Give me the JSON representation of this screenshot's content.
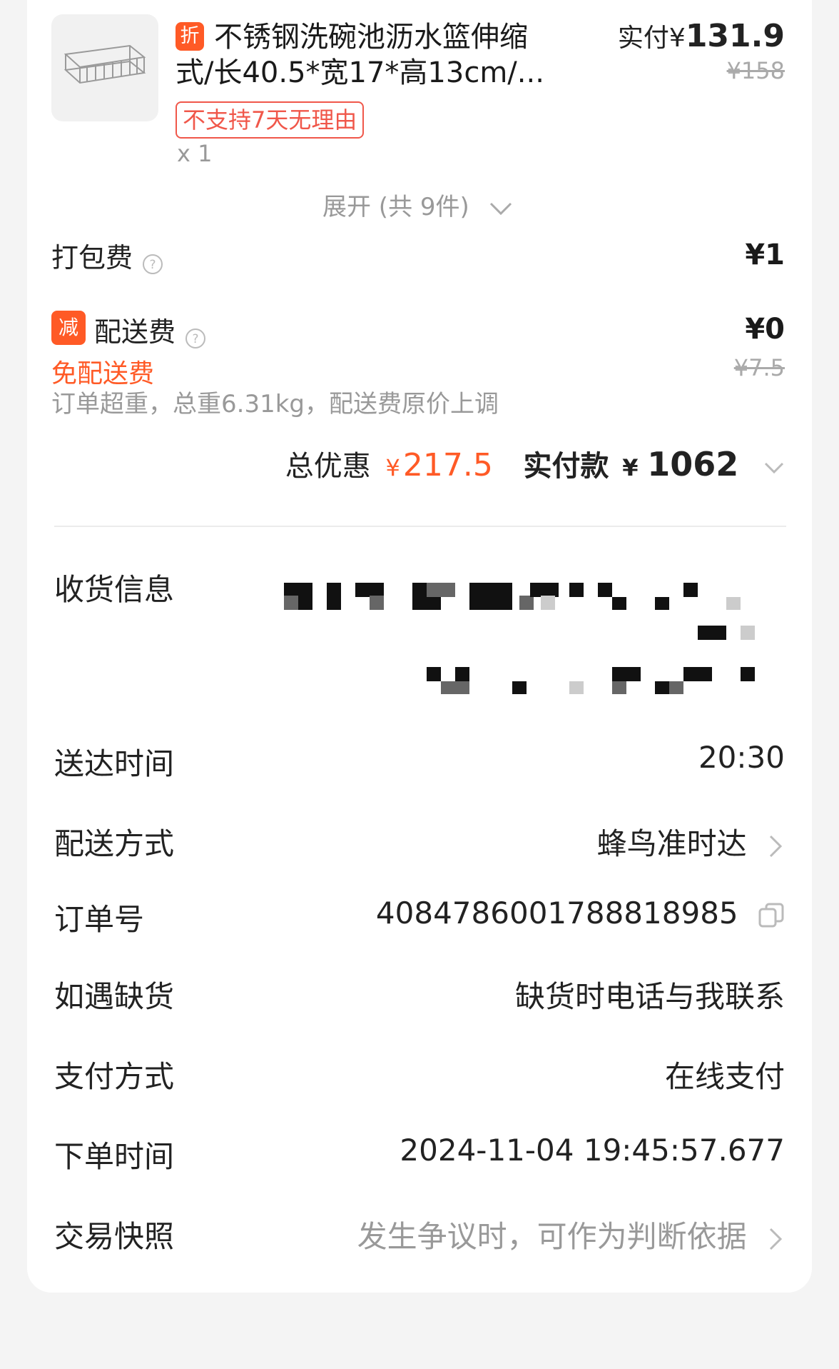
{
  "product": {
    "discount_tag": "折",
    "title_line1": "不锈钢洗碗池沥水篮伸缩",
    "title_line2": "式/长40.5*宽17*高13cm/...",
    "no_return_tag": "不支持7天无理由",
    "quantity": "x 1",
    "paid_label": "实付¥",
    "paid_amount": "131.9",
    "original_price": "¥158",
    "image_icon": "dish-rack-image"
  },
  "expand_label": "展开 (共 9件)",
  "packing_fee": {
    "label": "打包费",
    "amount": "¥1"
  },
  "delivery_fee": {
    "tag": "减",
    "label": "配送费",
    "amount": "¥0",
    "original": "¥7.5",
    "free_note": "免配送费",
    "overweight_note": "订单超重，总重6.31kg，配送费原价上调"
  },
  "totals": {
    "discount_label": "总优惠",
    "discount_currency": "¥",
    "discount_amount": "217.5",
    "paid_label": "实付款",
    "paid_currency": "¥",
    "paid_amount": "1062"
  },
  "info": {
    "address_label": "收货信息",
    "delivery_time_label": "送达时间",
    "delivery_time_value": "20:30",
    "delivery_method_label": "配送方式",
    "delivery_method_value": "蜂鸟准时达",
    "order_no_label": "订单号",
    "order_no_value": "4084786001788818985",
    "out_of_stock_label": "如遇缺货",
    "out_of_stock_value": "缺货时电话与我联系",
    "payment_label": "支付方式",
    "payment_value": "在线支付",
    "order_time_label": "下单时间",
    "order_time_value": "2024-11-04 19:45:57.677",
    "snapshot_label": "交易快照",
    "snapshot_value": "发生争议时，可作为判断依据"
  },
  "colors": {
    "accent": "#ff5a26",
    "tag_red": "#f0574a",
    "muted": "#999999"
  }
}
